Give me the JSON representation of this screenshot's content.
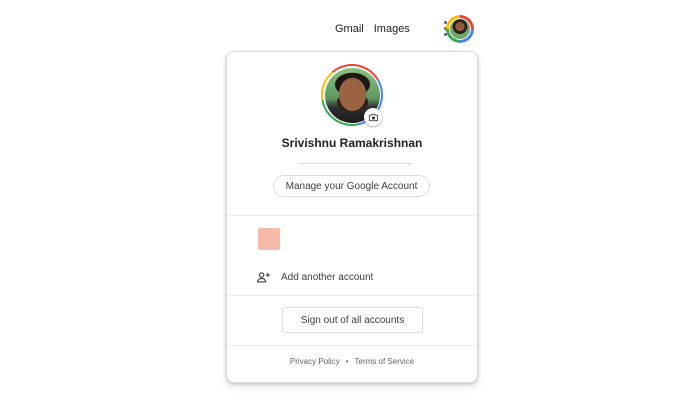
{
  "header": {
    "links": [
      {
        "label": "Gmail"
      },
      {
        "label": "Images"
      }
    ],
    "apps_icon": "apps-grid-icon",
    "avatar_icon": "profile-avatar"
  },
  "account_menu": {
    "user_name": "Srivishnu Ramakrishnan",
    "camera_icon": "camera-icon",
    "manage_button_label": "Manage your Google Account",
    "other_account_color": "#f7b9a8",
    "add_account_icon": "person-add-icon",
    "add_account_label": "Add another account",
    "sign_out_label": "Sign out of all accounts",
    "footer": {
      "privacy_label": "Privacy Policy",
      "separator": "•",
      "terms_label": "Terms of Service"
    }
  },
  "colors": {
    "google_red": "#ea4335",
    "google_blue": "#4285f4",
    "google_green": "#34a853",
    "google_yellow": "#fbbc05",
    "border": "#dadce0"
  }
}
